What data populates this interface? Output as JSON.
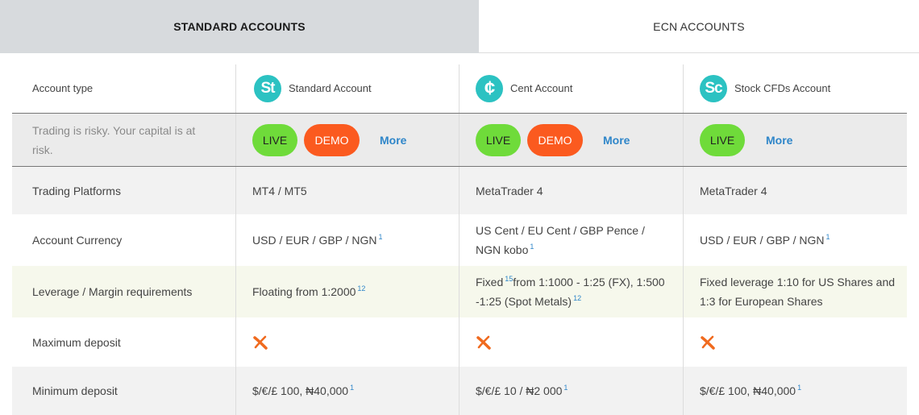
{
  "tabs": {
    "standard": "STANDARD ACCOUNTS",
    "ecn": "ECN ACCOUNTS"
  },
  "header": {
    "label": "Account type",
    "accounts": [
      {
        "icon": "St",
        "name": "Standard Account"
      },
      {
        "icon": "¢",
        "name": "Cent Account"
      },
      {
        "icon": "Sc",
        "name": "Stock CFDs Account"
      }
    ]
  },
  "buttons_row": {
    "label": "Trading is risky. Your capital is at risk.",
    "live": "LIVE",
    "demo": "DEMO",
    "more": "More"
  },
  "rows": {
    "platforms": {
      "label": "Trading Platforms",
      "values": [
        "MT4 / MT5",
        "MetaTrader 4",
        "MetaTrader 4"
      ]
    },
    "currency": {
      "label": "Account Currency",
      "values": [
        "USD / EUR / GBP / NGN",
        "US Cent / EU Cent / GBP Pence / NGN kobo",
        "USD / EUR / GBP / NGN"
      ],
      "notes": [
        "1",
        "1",
        "1"
      ]
    },
    "leverage": {
      "label": "Leverage / Margin requirements",
      "std": "Floating from 1:2000",
      "std_note": "12",
      "cent_a": "Fixed",
      "cent_note_a": "15",
      "cent_b": "from 1:1000 - 1:25 (FX), 1:500 -1:25 (Spot Metals)",
      "cent_note_b": "12",
      "stock": "Fixed leverage 1:10 for US Shares and 1:3 for European Shares"
    },
    "max_deposit": {
      "label": "Maximum deposit"
    },
    "min_deposit": {
      "label": "Minimum deposit",
      "values": [
        "$/€/£ 100, ₦40,000",
        "$/€/£ 10 / ₦2 000",
        "$/€/£ 100, ₦40,000"
      ],
      "notes": [
        "1",
        "1",
        "1"
      ]
    }
  },
  "colors": {
    "live": "#6fdb3a",
    "demo": "#fb5a1f",
    "accent": "#2f86c9",
    "logo": "#2cc2c2",
    "cross": "#f06a1e"
  }
}
